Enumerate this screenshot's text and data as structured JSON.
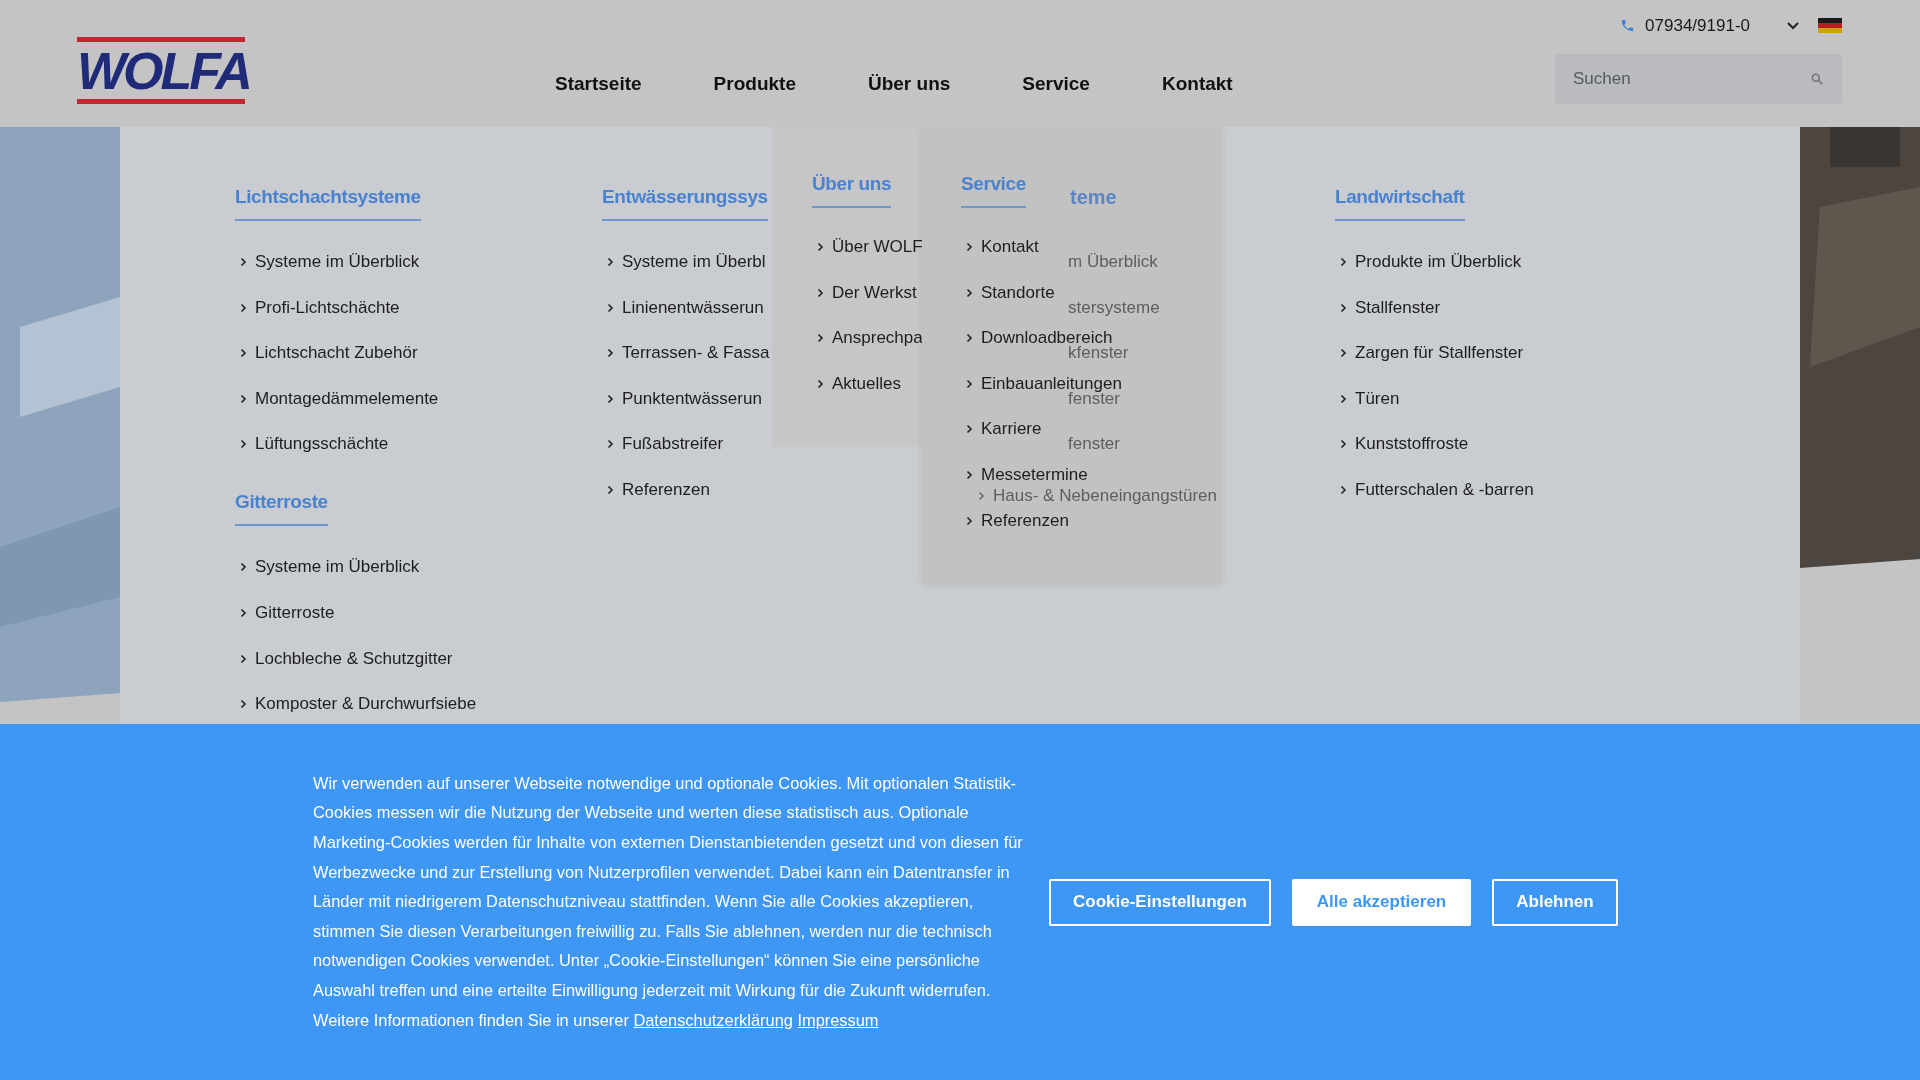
{
  "header": {
    "logo": "WOLFA",
    "phone": "07934/9191-0",
    "nav": [
      "Startseite",
      "Produkte",
      "Über uns",
      "Service",
      "Kontakt"
    ],
    "search": {
      "placeholder": "Suchen"
    }
  },
  "mega_menu": {
    "columns": [
      {
        "sections": [
          {
            "title": "Lichtschachtsysteme",
            "items": [
              "Systeme im Überblick",
              "Profi-Lichtschächte",
              "Lichtschacht Zubehör",
              "Montagedämmelemente",
              "Lüftungsschächte"
            ]
          },
          {
            "title": "Gitterroste",
            "items": [
              "Systeme im Überblick",
              "Gitterroste",
              "Lochbleche & Schutzgitter",
              "Komposter & Durchwurfsiebe"
            ]
          }
        ]
      },
      {
        "sections": [
          {
            "title": "Entwässerungssys",
            "items": [
              "Systeme im Überbl",
              "Linienentwässerun",
              "Terrassen- & Fassa",
              "Punktentwässerun",
              "Fußabstreifer",
              "Referenzen"
            ]
          }
        ]
      },
      {
        "fragments": {
          "title": "teme",
          "items": [
            {
              "text": "m Überblick",
              "chevron": false
            },
            {
              "text": "stersysteme",
              "chevron": false
            },
            {
              "text": "kfenster",
              "chevron": false
            },
            {
              "text": "fenster",
              "chevron": false
            },
            {
              "text": "fenster",
              "chevron": false
            },
            {
              "text": "Haus- & Nebeneingangstüren",
              "chevron": true
            }
          ]
        }
      },
      {
        "sections": [
          {
            "title": "Landwirtschaft",
            "items": [
              "Produkte im Überblick",
              "Stallfenster",
              "Zargen für Stallfenster",
              "Türen",
              "Kunststoffroste",
              "Futterschalen & -barren"
            ]
          }
        ]
      }
    ]
  },
  "dropdowns": [
    {
      "title": "Über uns",
      "items": [
        "Über WOLF",
        "Der Werkst",
        "Ansprechpa",
        "Aktuelles"
      ]
    },
    {
      "title": "Service",
      "items": [
        "Kontakt",
        "Standorte",
        "Downloadbereich",
        "Einbauanleitungen",
        "Karriere",
        "Messetermine",
        "Referenzen"
      ]
    }
  ],
  "cookie_banner": {
    "text": "Wir verwenden auf unserer Webseite notwendige und optionale Cookies. Mit optionalen Statistik-Cookies messen wir die Nutzung der Webseite und werten diese statistisch aus. Optionale Marketing-Cookies werden für Inhalte von externen Dienstanbietenden gesetzt und von diesen für Werbezwecke und zur Erstellung von Nutzerprofilen verwendet. Dabei kann ein Datentransfer in Länder mit niedrigerem Datenschutzniveau stattfinden. Wenn Sie alle Cookies akzeptieren, stimmen Sie diesen Verarbeitungen freiwillig zu. Falls Sie ablehnen, werden nur die technisch notwendigen Cookies verwendet. Unter „Cookie-Einstellungen“ können Sie eine persönliche Auswahl treffen und eine erteilte Einwilligung jederzeit mit Wirkung für die Zukunft widerrufen. Weitere Informationen finden Sie in unserer",
    "links": [
      "Datenschutzerklärung",
      "Impressum"
    ],
    "buttons": [
      {
        "label": "Cookie-Einstellungen",
        "kind": "outline"
      },
      {
        "label": "Alle akzeptieren",
        "kind": "filled"
      },
      {
        "label": "Ablehnen",
        "kind": "outline"
      }
    ]
  }
}
